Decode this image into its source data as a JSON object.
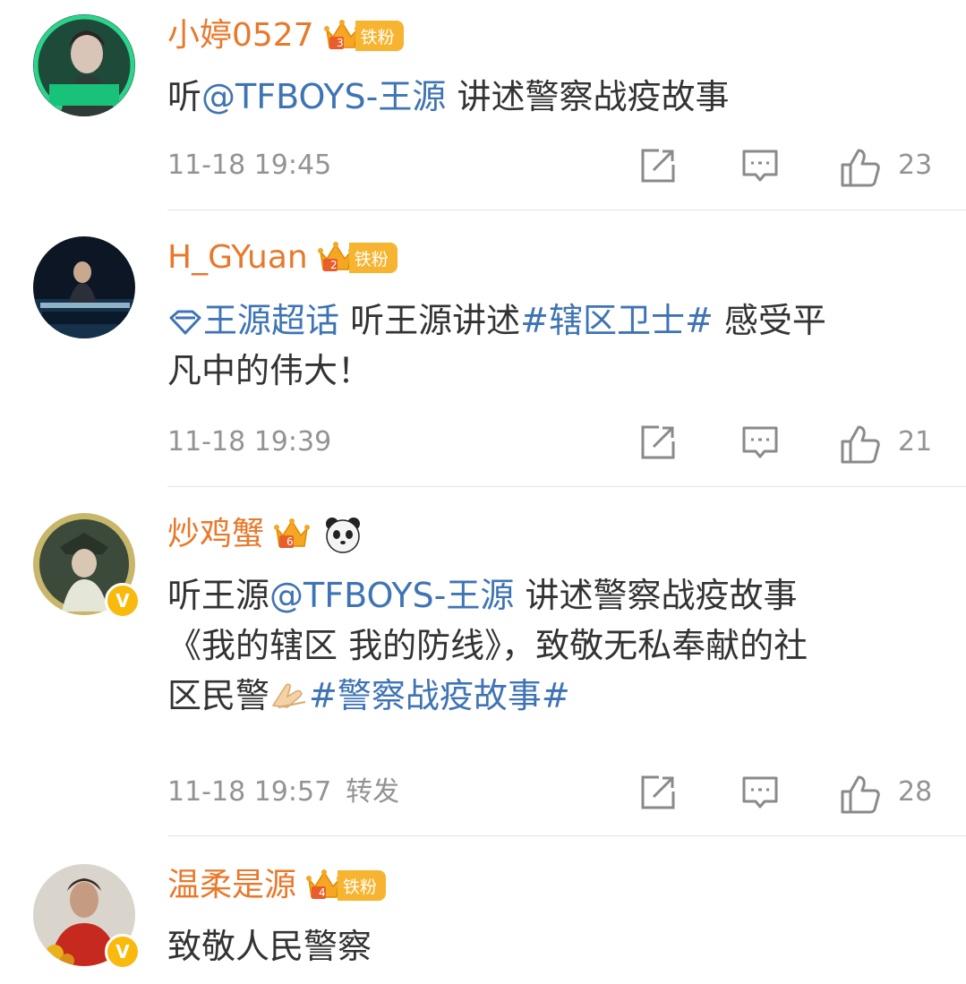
{
  "colors": {
    "username": "#e8792b",
    "link": "#3f74b4",
    "meta": "#939393",
    "fan_badge": "#f7b430",
    "verified": "#f9b90d"
  },
  "comments": [
    {
      "username": "小婷0527",
      "crown_level": "3",
      "fan_badge": "铁粉",
      "text": [
        {
          "t": "听"
        },
        {
          "t": "@TFBOYS-王源",
          "link": true
        },
        {
          "t": " 讲述警察战疫故事"
        }
      ],
      "timestamp": "11-18 19:45",
      "forward_label": "",
      "likes": "23",
      "verified": false
    },
    {
      "username": "H_GYuan",
      "crown_level": "2",
      "fan_badge": "铁粉",
      "text_line1": [
        {
          "t": "王源超话",
          "link": true,
          "icon": "supertopic-diamond-icon"
        },
        {
          "t": " 听王源讲述"
        },
        {
          "t": "#辖区卫士#",
          "link": true
        },
        {
          "t": " 感受平"
        }
      ],
      "text_line2": "凡中的伟大！",
      "timestamp": "11-18 19:39",
      "forward_label": "",
      "likes": "21",
      "verified": false
    },
    {
      "username": "炒鸡蟹",
      "crown_level": "6",
      "fan_badge": "",
      "emoji": "panda-icon",
      "text_line1_a": "听王源",
      "text_line1_link": "@TFBOYS-王源",
      "text_line1_b": " 讲述警察战疫故事",
      "text_line2": "《我的辖区 我的防线》，致敬无私奉献的社",
      "text_line3_a": "区民警",
      "text_line3_emoji": "praying-hands-icon",
      "text_line3_link": "#警察战疫故事#",
      "timestamp": "11-18 19:57",
      "forward_label": "转发",
      "likes": "28",
      "verified": true
    },
    {
      "username": "温柔是源",
      "crown_level": "4",
      "fan_badge": "铁粉",
      "text": "致敬人民警察",
      "verified": true
    }
  ],
  "actions": {
    "share_icon": "share-icon",
    "comment_icon": "comment-icon",
    "like_icon": "thumbs-up-icon"
  }
}
